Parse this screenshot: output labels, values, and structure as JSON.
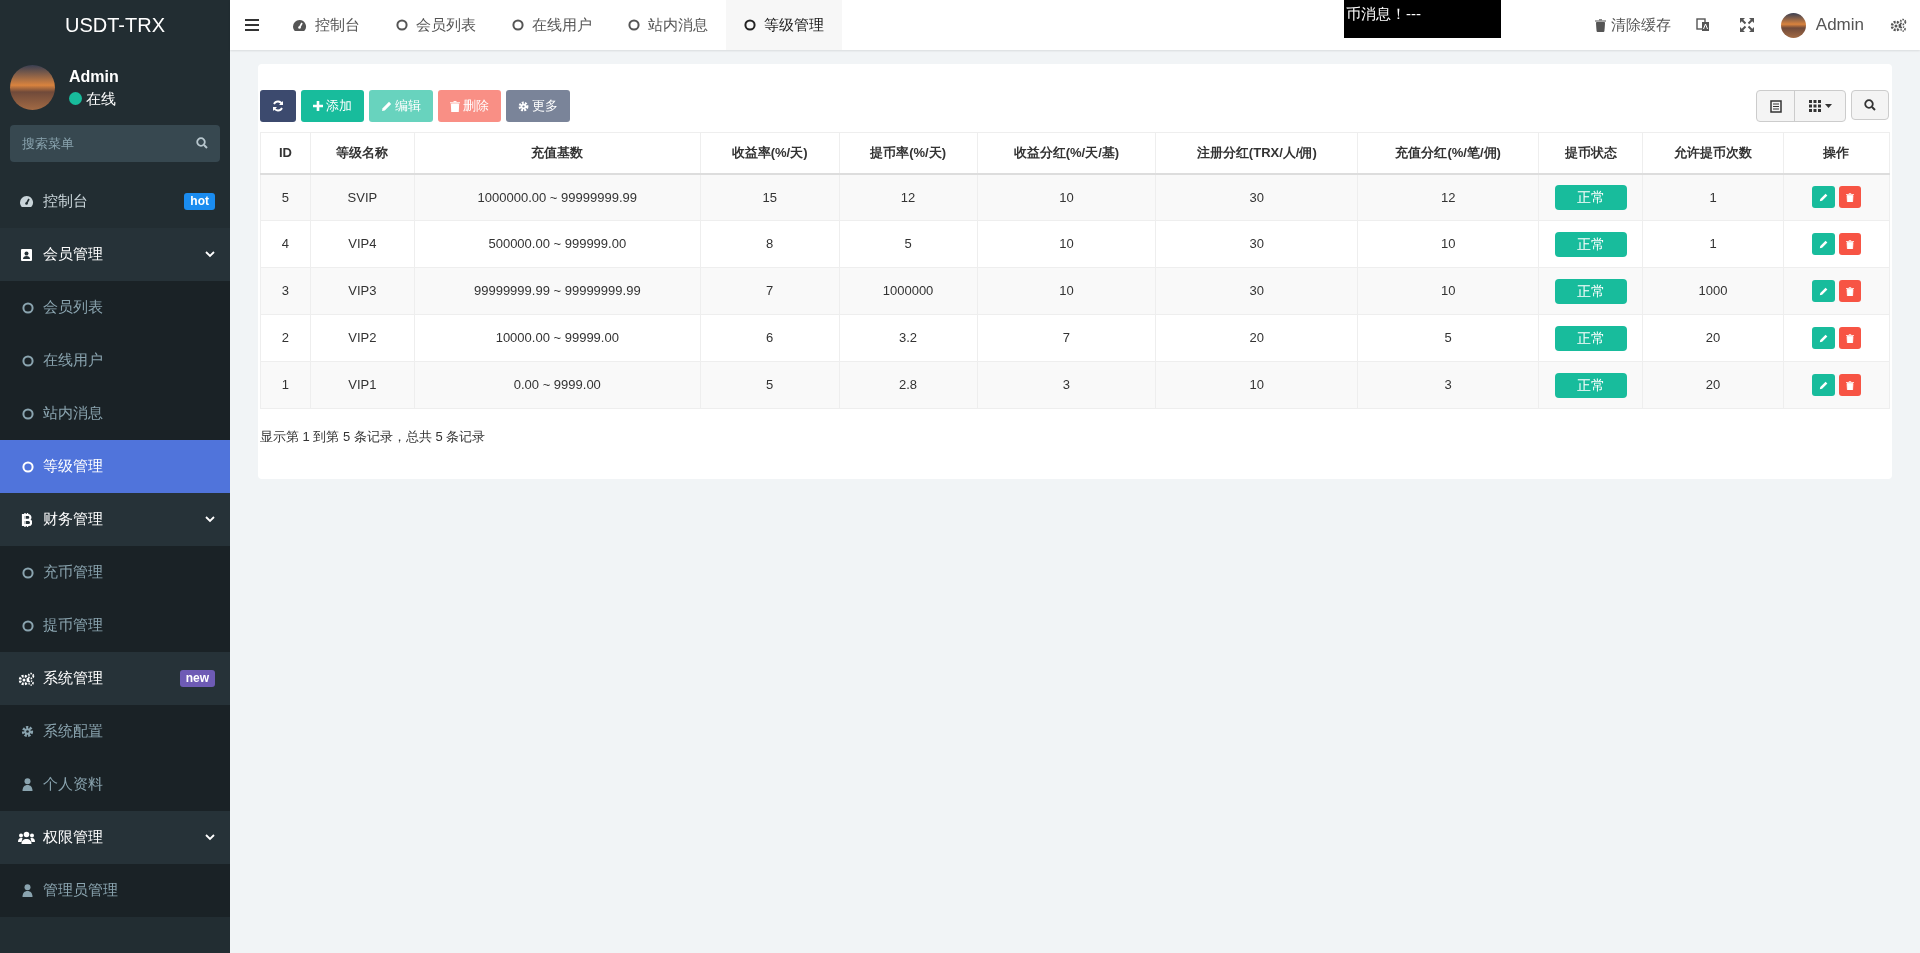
{
  "sidebar": {
    "logo": "USDT-TRX",
    "user": {
      "name": "Admin",
      "status": "在线"
    },
    "search": {
      "placeholder": "搜索菜单"
    },
    "menu": [
      {
        "kind": "link",
        "label": "控制台",
        "badge": "hot",
        "color": "#1a8cf0"
      },
      {
        "kind": "group",
        "label": "会员管理",
        "expanded": true,
        "children": [
          {
            "label": "会员列表",
            "selected": false
          },
          {
            "label": "在线用户",
            "selected": false
          },
          {
            "label": "站内消息",
            "selected": false
          },
          {
            "label": "等级管理",
            "selected": true
          }
        ]
      },
      {
        "kind": "group",
        "label": "财务管理",
        "expanded": true,
        "children": [
          {
            "label": "充币管理",
            "selected": false
          },
          {
            "label": "提币管理",
            "selected": false
          }
        ]
      },
      {
        "kind": "group",
        "label": "系统管理",
        "badge": "new",
        "color": "#6e5bb5",
        "expanded": true,
        "children": [
          {
            "label": "系统配置",
            "selected": false
          },
          {
            "label": "个人资料",
            "selected": false
          }
        ]
      },
      {
        "kind": "group",
        "label": "权限管理",
        "expanded": true,
        "children": [
          {
            "label": "管理员管理",
            "selected": false
          }
        ]
      }
    ]
  },
  "topbar": {
    "tabs": [
      {
        "label": "控制台",
        "selected": false
      },
      {
        "label": "会员列表",
        "selected": false
      },
      {
        "label": "在线用户",
        "selected": false
      },
      {
        "label": "站内消息",
        "selected": false
      },
      {
        "label": "等级管理",
        "selected": true
      }
    ],
    "notice": "币消息！---",
    "clear_cache": "清除缓存",
    "user": "Admin"
  },
  "toolbar": {
    "buttons": [
      {
        "kind": "refresh",
        "disabled": false
      },
      {
        "kind": "add",
        "label": "添加",
        "disabled": false
      },
      {
        "kind": "edit",
        "label": "编辑",
        "disabled": true
      },
      {
        "kind": "delete",
        "label": "删除",
        "disabled": true
      },
      {
        "kind": "more",
        "label": "更多",
        "disabled": false
      }
    ]
  },
  "table": {
    "columns": [
      "ID",
      "等级名称",
      "充值基数",
      "收益率(%/天)",
      "提币率(%/天)",
      "收益分红(%/天/基)",
      "注册分红(TRX/人/佣)",
      "充值分红(%/笔/佣)",
      "提币状态",
      "允许提币次数",
      "操作"
    ],
    "rows": [
      {
        "cells": [
          "5",
          "SVIP",
          "1000000.00 ~ 99999999.99",
          "15",
          "12",
          "10",
          "30",
          "12"
        ],
        "status": "正常",
        "count": "1"
      },
      {
        "cells": [
          "4",
          "VIP4",
          "500000.00 ~ 999999.00",
          "8",
          "5",
          "10",
          "30",
          "10"
        ],
        "status": "正常",
        "count": "1"
      },
      {
        "cells": [
          "3",
          "VIP3",
          "99999999.99 ~ 99999999.99",
          "7",
          "1000000",
          "10",
          "30",
          "10"
        ],
        "status": "正常",
        "count": "1000"
      },
      {
        "cells": [
          "2",
          "VIP2",
          "10000.00 ~ 99999.00",
          "6",
          "3.2",
          "7",
          "20",
          "5"
        ],
        "status": "正常",
        "count": "20"
      },
      {
        "cells": [
          "1",
          "VIP1",
          "0.00 ~ 9999.00",
          "5",
          "2.8",
          "3",
          "10",
          "3"
        ],
        "status": "正常",
        "count": "20"
      }
    ]
  },
  "pagination": "显示第 1 到第 5 条记录，总共 5 条记录"
}
